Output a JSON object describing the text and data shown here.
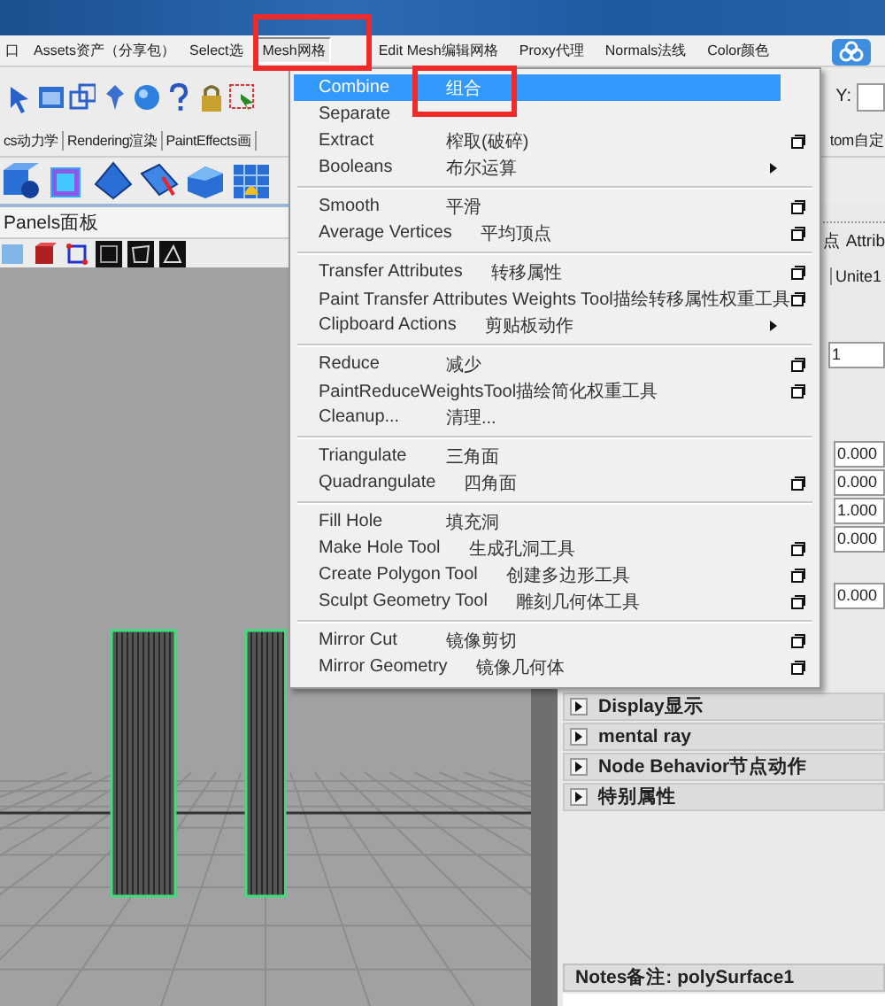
{
  "menubar": {
    "items": [
      {
        "label": "口",
        "selected": false
      },
      {
        "label": "Assets资产（分享包）",
        "selected": false
      },
      {
        "label": "Select选",
        "selected": false
      },
      {
        "label": "Mesh网格",
        "selected": true
      },
      {
        "label": "Edit Mesh编辑网格",
        "selected": false
      },
      {
        "label": "Proxy代理",
        "selected": false
      },
      {
        "label": "Normals法线",
        "selected": false
      },
      {
        "label": "Color颜色",
        "selected": false
      }
    ]
  },
  "toolbar": {
    "y_label": "Y:"
  },
  "shelf": {
    "tabs": [
      "cs动力学",
      "Rendering渲染",
      "PaintEffects画"
    ],
    "right_tab": "tom自定"
  },
  "menu": {
    "groups": [
      {
        "items": [
          {
            "label": "Combine",
            "label_cn": "组合",
            "kind": "plain",
            "selected": true
          },
          {
            "label": "Separate",
            "kind": "plain",
            "selected": false
          },
          {
            "label": "Extract",
            "label_cn": "榨取(破碎)",
            "kind": "option",
            "selected": false
          },
          {
            "label": "Booleans",
            "label_cn": "布尔运算",
            "kind": "submenu",
            "selected": false
          }
        ]
      },
      {
        "items": [
          {
            "label": "Smooth",
            "label_cn": "平滑",
            "kind": "option",
            "selected": false
          },
          {
            "label": "Average Vertices",
            "label_cn": "平均顶点",
            "kind": "option",
            "selected": false
          }
        ]
      },
      {
        "items": [
          {
            "label": "Transfer Attributes",
            "label_cn": "转移属性",
            "kind": "option",
            "selected": false
          },
          {
            "label": "Paint Transfer Attributes Weights Tool描绘转移属性权重工具",
            "kind": "option",
            "selected": false
          },
          {
            "label": "Clipboard Actions",
            "label_cn": "剪贴板动作",
            "kind": "submenu",
            "selected": false
          }
        ]
      },
      {
        "items": [
          {
            "label": "Reduce",
            "label_cn": "减少",
            "kind": "option",
            "selected": false
          },
          {
            "label": "PaintReduceWeightsTool描绘简化权重工具",
            "kind": "option",
            "selected": false
          },
          {
            "label": "Cleanup...",
            "label_cn": "清理...",
            "kind": "plain",
            "selected": false
          }
        ]
      },
      {
        "items": [
          {
            "label": "Triangulate",
            "label_cn": "三角面",
            "kind": "plain",
            "selected": false
          },
          {
            "label": "Quadrangulate",
            "label_cn": "四角面",
            "kind": "option",
            "selected": false
          }
        ]
      },
      {
        "items": [
          {
            "label": "Fill Hole",
            "label_cn": "填充洞",
            "kind": "plain",
            "selected": false
          },
          {
            "label": "Make Hole Tool",
            "label_cn": "生成孔洞工具",
            "kind": "option",
            "selected": false
          },
          {
            "label": "Create Polygon Tool",
            "label_cn": "创建多边形工具",
            "kind": "option",
            "selected": false
          },
          {
            "label": "Sculpt Geometry Tool",
            "label_cn": "雕刻几何体工具",
            "kind": "option",
            "selected": false
          }
        ]
      },
      {
        "items": [
          {
            "label": "Mirror Cut",
            "label_cn": "镜像剪切",
            "kind": "option",
            "selected": false
          },
          {
            "label": "Mirror Geometry",
            "label_cn": "镜像几何体",
            "kind": "option",
            "selected": false
          }
        ]
      }
    ]
  },
  "viewport": {
    "panels_label": "Panels面板"
  },
  "attribute_editor": {
    "tabs": [
      "点",
      "Attrib"
    ],
    "node_tabs": [
      "Unite1"
    ],
    "name_value": "1",
    "values": [
      "0.000",
      "0.000",
      "1.000",
      "0.000"
    ],
    "extra_value": "0.000",
    "sections": [
      "Display显示",
      "mental ray",
      "Node Behavior节点动作",
      "特别属性"
    ],
    "notes": "Notes备注: polySurface1"
  }
}
